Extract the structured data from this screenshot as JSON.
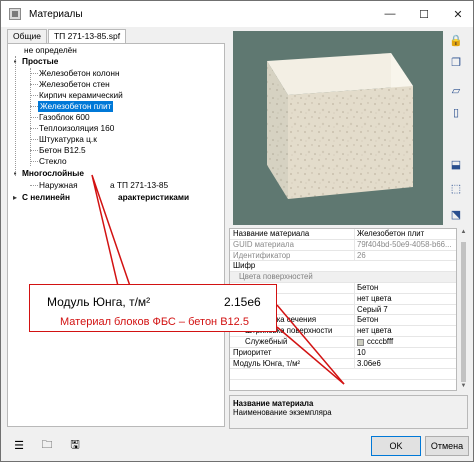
{
  "window": {
    "title": "Материалы",
    "minimize": "—",
    "maximize": "☐",
    "close": "✕"
  },
  "tabs": [
    "Общие",
    "ТП 271-13-85.spf"
  ],
  "tree": {
    "not_defined": "не определён",
    "simple": "Простые",
    "items": [
      "Железобетон колонн",
      "Железобетон стен",
      "Кирпич керамический",
      "Железобетон плит",
      "Газоблок 600",
      "Теплоизоляция 160",
      "Штукатурка ц.к",
      "Бетон B12.5",
      "Стекло"
    ],
    "multilayer": "Многослойные",
    "multilayer_item_left": "Наружная",
    "multilayer_item_right": "а ТП 271-13-85",
    "nonlinear_right": "арактеристиками",
    "nonlinear_left": "С нелинейн"
  },
  "properties": [
    {
      "name": "Название материала",
      "value": "Железобетон плит"
    },
    {
      "name": "GUID материала",
      "value": "79f404bd-50e9-4058-b66..."
    },
    {
      "name": "Идентификатор",
      "value": "26"
    },
    {
      "name": "Шифр",
      "value": ""
    },
    {
      "name": "Цвета поверхностей",
      "value": ""
    },
    {
      "name": "",
      "value": "Бетон"
    },
    {
      "name": "",
      "value": "нет цвета"
    },
    {
      "name": "",
      "value": "Серый 7"
    },
    {
      "name": "Штриховка сечения",
      "value": "Бетон"
    },
    {
      "name": "Штриховка поверхности",
      "value": "нет цвета"
    },
    {
      "name": "Служебный",
      "value": "ccccbfff"
    },
    {
      "name": "Приоритет",
      "value": "10"
    },
    {
      "name": "Модуль Юнга, т/м²",
      "value": "3.06e6"
    },
    {
      "name": "",
      "value": ""
    }
  ],
  "description": {
    "title": "Название материала",
    "text": "Наименование экземпляра"
  },
  "buttons": {
    "ok": "OK",
    "cancel": "Отмена"
  },
  "callout": {
    "label": "Модуль Юнга, т/м²",
    "value": "2.15e6",
    "note": "Материал блоков ФБС – бетон B12.5"
  },
  "colors": {
    "selection": "#0078d7",
    "callout": "#d21212",
    "preview_bg": "#5f7871",
    "slab_top": "#e9e4d6",
    "slab_front": "#ddd6c5",
    "slab_side": "#f6f2e8"
  },
  "icons": {
    "app": "materials-icon",
    "right_toolbar": [
      "lock-icon",
      "copy-layers-icon",
      "shape-front-icon",
      "shape-side-icon",
      "light-icon",
      "frame-icon",
      "texture-icon"
    ],
    "bottom_toolbar": [
      "list-icon",
      "open-folder-icon",
      "save-icon"
    ]
  }
}
